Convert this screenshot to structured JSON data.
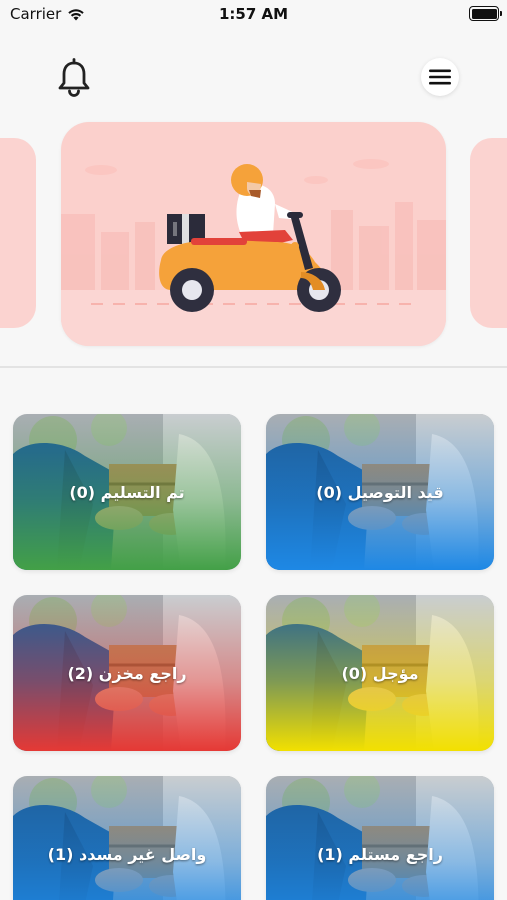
{
  "status_bar": {
    "carrier": "Carrier",
    "time": "1:57 AM",
    "wifi_icon": "wifi-icon",
    "battery_icon": "battery-icon"
  },
  "header": {
    "notification_icon": "bell-icon",
    "menu_icon": "hamburger-menu-icon"
  },
  "banner": {
    "illustration": "delivery-scooter-illustration"
  },
  "colors": {
    "banner_bg": "#fbd0cc",
    "scooter": "#f5a23a",
    "rider_pants": "#e2423a"
  },
  "cards": [
    {
      "label": "قيد التوصيل (0)",
      "tint": "#1e88e5"
    },
    {
      "label": "تم التسليم (0)",
      "tint": "#43a047"
    },
    {
      "label": "مؤجل (0)",
      "tint": "#f2e000"
    },
    {
      "label": "راجع مخزن (2)",
      "tint": "#e53935"
    },
    {
      "label": "راجع مستلم (1)",
      "tint": "#1e88e5"
    },
    {
      "label": "واصل غير مسدد (1)",
      "tint": "#1e88e5"
    }
  ]
}
